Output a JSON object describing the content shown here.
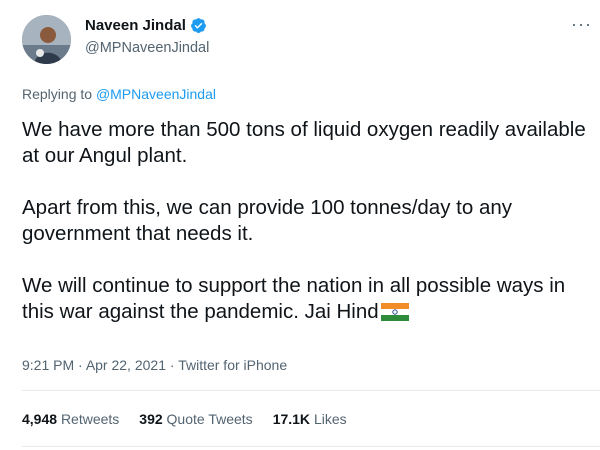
{
  "author": {
    "name": "Naveen Jindal",
    "handle": "@MPNaveenJindal",
    "verified": true
  },
  "reply": {
    "prefix": "Replying to ",
    "to": "@MPNaveenJindal"
  },
  "body": {
    "p1": "We have more than 500 tons of liquid oxygen readily available at our Angul plant.",
    "p2": "Apart from this, we can provide 100 tonnes/day to any government that needs it.",
    "p3": "We will continue to support the nation in all possible ways in this war against the pandemic. Jai Hind"
  },
  "meta": {
    "time": "9:21 PM",
    "date": "Apr 22, 2021",
    "source": "Twitter for iPhone",
    "separator": " · "
  },
  "stats": {
    "retweets_count": "4,948",
    "retweets_label": "Retweets",
    "quotes_count": "392",
    "quotes_label": "Quote Tweets",
    "likes_count": "17.1K",
    "likes_label": "Likes"
  },
  "more_label": "···",
  "colors": {
    "accent": "#1d9bf0",
    "text": "#0f1419",
    "muted": "#536471"
  }
}
